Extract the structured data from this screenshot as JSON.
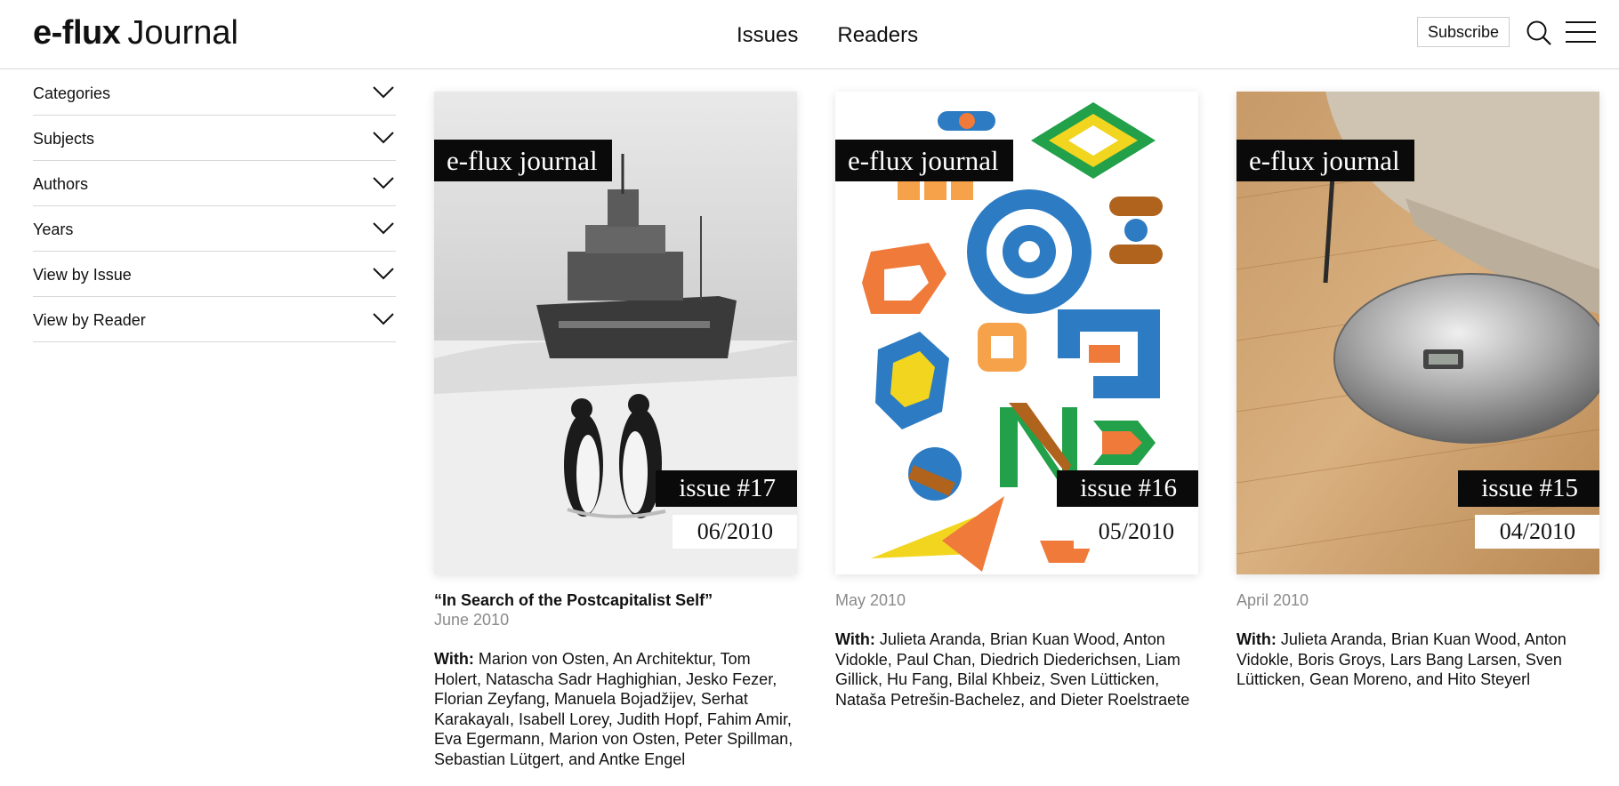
{
  "header": {
    "logo_bold": "e-flux",
    "logo_rest": "Journal",
    "nav": [
      "Issues",
      "Readers"
    ],
    "subscribe_label": "Subscribe",
    "search_icon": "search-icon",
    "menu_icon": "hamburger-menu-icon"
  },
  "sidebar": {
    "items": [
      {
        "label": "Categories"
      },
      {
        "label": "Subjects"
      },
      {
        "label": "Authors"
      },
      {
        "label": "Years"
      },
      {
        "label": "View by Issue"
      },
      {
        "label": "View by Reader"
      }
    ],
    "chevron_icon": "chevron-down-icon"
  },
  "issues": [
    {
      "brand": "e-flux journal",
      "issue_label": "issue #17",
      "issue_date": "06/2010",
      "title": "“In Search of the Postcapitalist Self”",
      "date": "June 2010",
      "with_label": "With:",
      "contributors": "Marion von Osten, An Architektur, Tom Holert, Natascha Sadr Haghighian, Jesko Fezer, Florian Zeyfang, Manuela Bojadžijev, Serhat Karakayalı, Isabell Lorey, Judith Hopf, Fahim Amir, Eva Egermann, Marion von Osten, Peter Spillman, Sebastian Lütgert, and Antke Engel"
    },
    {
      "brand": "e-flux journal",
      "issue_label": "issue #16",
      "issue_date": "05/2010",
      "date": "May 2010",
      "with_label": "With:",
      "contributors": "Julieta Aranda, Brian Kuan Wood, Anton Vidokle, Paul Chan, Diedrich Diederichsen, Liam Gillick, Hu Fang, Bilal Khbeiz, Sven Lütticken, Nataša Petrešin-Bachelez, and Dieter Roelstraete"
    },
    {
      "brand": "e-flux journal",
      "issue_label": "issue #15",
      "issue_date": "04/2010",
      "date": "April 2010",
      "with_label": "With:",
      "contributors": "Julieta Aranda, Brian Kuan Wood, Anton Vidokle, Boris Groys, Lars Bang Larsen, Sven Lütticken, Gean Moreno, and Hito Steyerl"
    }
  ]
}
